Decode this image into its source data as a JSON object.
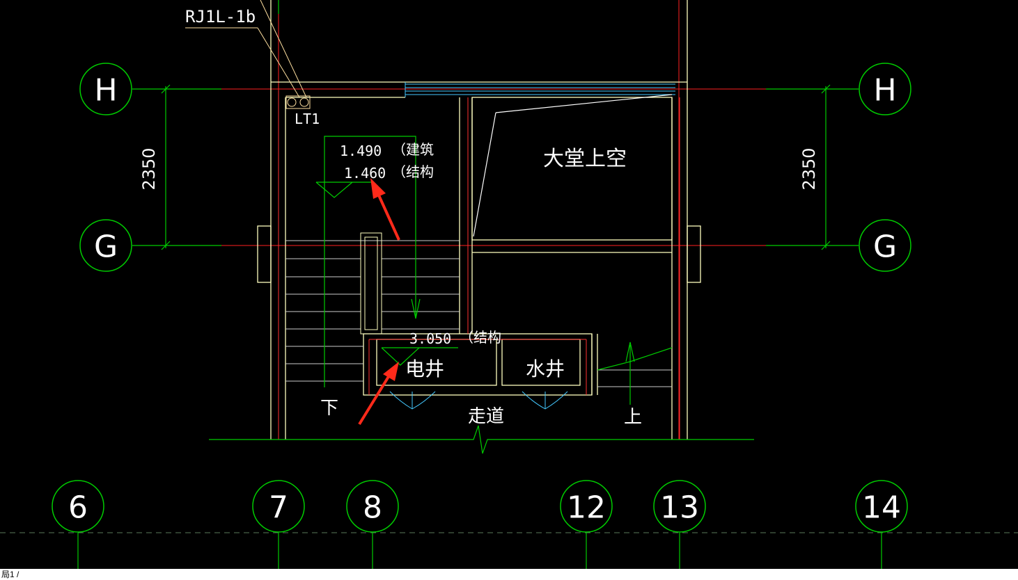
{
  "drawing": {
    "grid_rows": [
      "H",
      "G"
    ],
    "grid_columns": [
      "6",
      "7",
      "8",
      "12",
      "13",
      "14"
    ],
    "dimension_left": "2350",
    "dimension_right": "2350",
    "line_tag": "RJ1L-1b",
    "pipe_tag": "LT1",
    "elev_arch_value": "1.490",
    "elev_arch_note": "（建筑",
    "elev_struct_value": "1.460",
    "elev_struct_note": "（结构",
    "elev_shaft_value": "3.050",
    "elev_shaft_note": "（结构",
    "lobby_void": "大堂上空",
    "electrical_shaft": "电井",
    "water_shaft": "水井",
    "corridor": "走道",
    "stair_down": "下",
    "stair_up": "上"
  },
  "status_bar": {
    "tab": "局1 /"
  },
  "colors": {
    "background": "#000000",
    "grid_line": "#00cc00",
    "axis_line": "#ff2020",
    "wall": "#ffffc0",
    "text": "#ffffff",
    "arrow": "#ff2a1a",
    "tag_leader": "#ffe0a0"
  }
}
